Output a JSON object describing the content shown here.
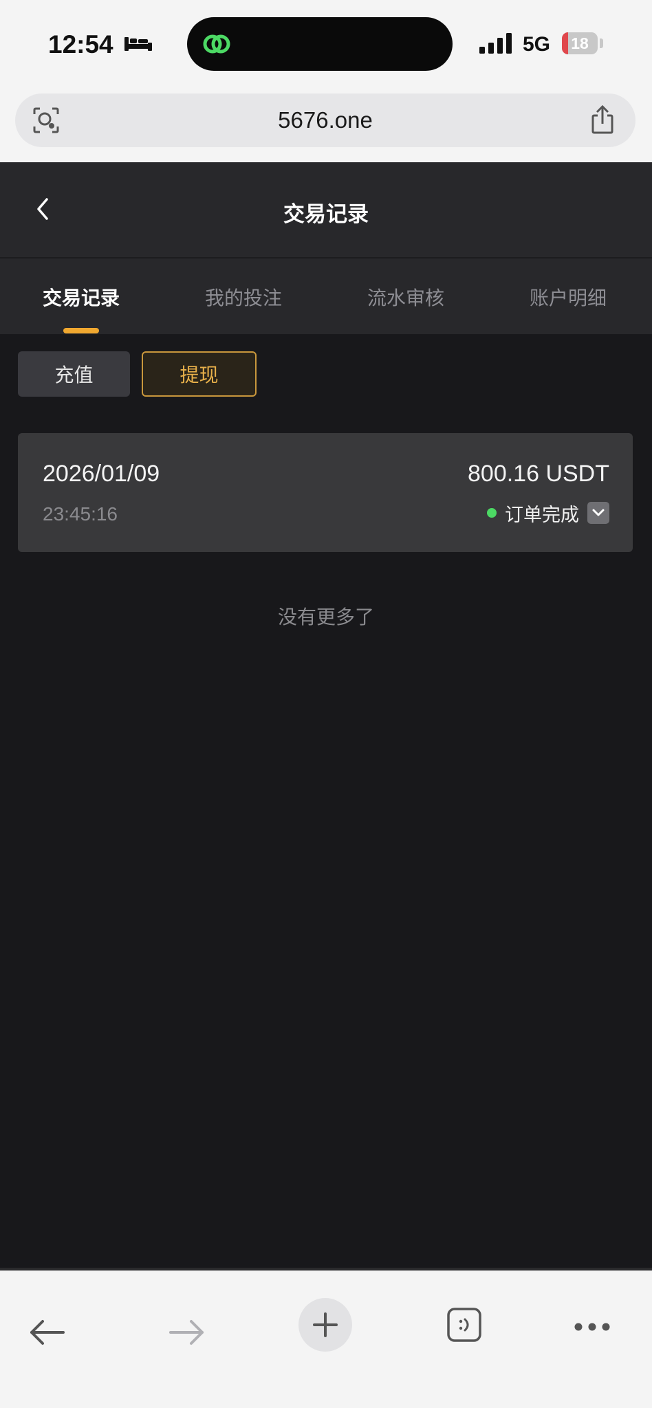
{
  "status_bar": {
    "time": "12:54",
    "network": "5G",
    "battery_level": "18",
    "battery_fill_percent": 18,
    "icons": [
      "bed-icon",
      "island-app-icon",
      "signal-icon",
      "battery-icon"
    ]
  },
  "browser": {
    "url": "5676.one",
    "icons": [
      "lens-icon",
      "share-icon"
    ]
  },
  "header": {
    "title": "交易记录",
    "back_icon": "chevron-left-icon"
  },
  "tabs": [
    {
      "label": "交易记录",
      "active": true
    },
    {
      "label": "我的投注",
      "active": false
    },
    {
      "label": "流水审核",
      "active": false
    },
    {
      "label": "账户明细",
      "active": false
    }
  ],
  "filters": {
    "deposit_label": "充值",
    "withdraw_label": "提现",
    "selected": "提现"
  },
  "records": [
    {
      "date": "2026/01/09",
      "time": "23:45:16",
      "amount": "800.16 USDT",
      "status": "订单完成",
      "status_color": "#4cd964"
    }
  ],
  "footer": {
    "no_more": "没有更多了"
  },
  "toolbar": {
    "icons": [
      "back-arrow-icon",
      "forward-arrow-icon",
      "plus-icon",
      "tabs-icon",
      "more-icon"
    ]
  },
  "colors": {
    "accent": "#f0a830",
    "background": "#18181b",
    "header": "#28282b",
    "card": "#39393b"
  }
}
